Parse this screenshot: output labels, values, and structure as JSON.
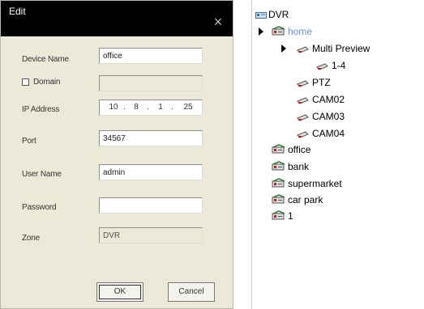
{
  "dialog": {
    "title": "Edit",
    "close_glyph": "×",
    "device_name_label": "Device Name",
    "device_name_value": "office",
    "domain_label": "Domain",
    "domain_value": "",
    "ip_label": "IP Address",
    "ip": [
      "10",
      "8",
      "1",
      "25"
    ],
    "ip_dot": ".",
    "port_label": "Port",
    "port_value": "34567",
    "username_label": "User Name",
    "username_value": "admin",
    "password_label": "Password",
    "password_value": "",
    "zone_label": "Zone",
    "zone_value": "DVR",
    "ok_label": "OK",
    "cancel_label": "Cancel"
  },
  "tree": {
    "root_label": "DVR",
    "home_label": "home",
    "multi_preview_label": "Multi Preview",
    "group_label": "1-4",
    "ptz_label": "PTZ",
    "cam02_label": "CAM02",
    "cam03_label": "CAM03",
    "cam04_label": "CAM04",
    "office_label": "office",
    "bank_label": "bank",
    "supermarket_label": "supermarket",
    "car_park_label": "car park",
    "one_label": "1",
    "icons": {
      "root": "dvr-icon",
      "device": "dvr-device-icon",
      "camera": "camera-icon"
    },
    "selected_color": "#6a8fd8"
  }
}
